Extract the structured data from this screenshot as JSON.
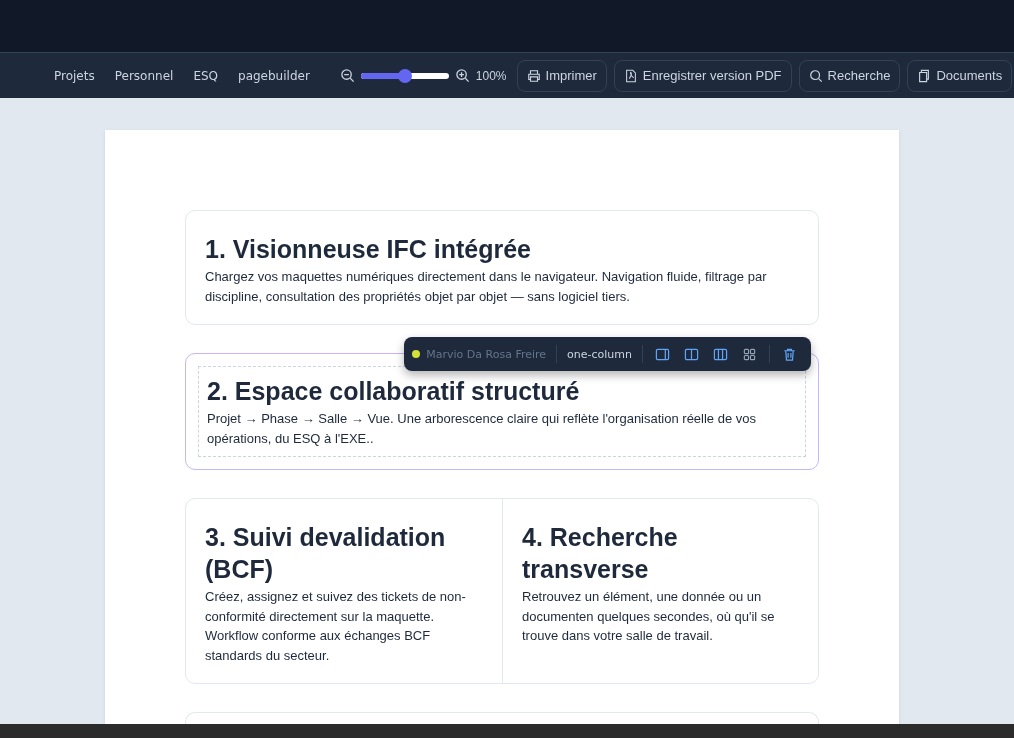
{
  "nav": [
    "Projets",
    "Personnel",
    "ESQ",
    "pagebuilder"
  ],
  "zoom": {
    "level": 0.5,
    "reading": "100%"
  },
  "actions": [
    {
      "kind": "print",
      "label": "Imprimer"
    },
    {
      "kind": "pdf",
      "label": "Enregistrer version PDF"
    },
    {
      "kind": "search",
      "label": "Recherche"
    },
    {
      "kind": "documents",
      "label": "Documents"
    }
  ],
  "blocks": [
    {
      "selected": false,
      "columns": [
        {
          "heading": "1. Visionneuse IFC intégrée",
          "text": "Chargez vos maquettes numériques directement dans le navigateur. Navigation fluide, filtrage par discipline, consultation des propriétés objet par objet — sans logiciel tiers."
        }
      ]
    },
    {
      "selected": true,
      "columns": [
        {
          "heading": "2. Espace collaboratif structuré",
          "text": "Projet → Phase → Salle → Vue. Une arborescence claire qui reflète l'organisation réelle de vos opérations, du ESQ à l'EXE.."
        }
      ]
    },
    {
      "selected": false,
      "columns": [
        {
          "heading": "3. Suivi devalidation (BCF)",
          "text": " Créez, assignez et suivez des tickets de non-conformité directement sur la maquette. Workflow conforme aux échanges BCF standards du secteur."
        },
        {
          "heading": "4. Recherche transverse",
          "text": " Retrouvez un élément, une donnée ou un documenten quelques secondes, où qu'il se trouve dans votre salle de travail."
        }
      ]
    },
    {
      "selected": false
    }
  ],
  "block_toolbar": {
    "user": "Marvio Da Rosa Freire",
    "color": "#d4e03a",
    "layout": "one-column",
    "tools": [
      {
        "kind": "sidebar"
      },
      {
        "kind": "two"
      },
      {
        "kind": "three"
      },
      {
        "kind": "grid"
      },
      {
        "kind": "delete"
      }
    ]
  }
}
